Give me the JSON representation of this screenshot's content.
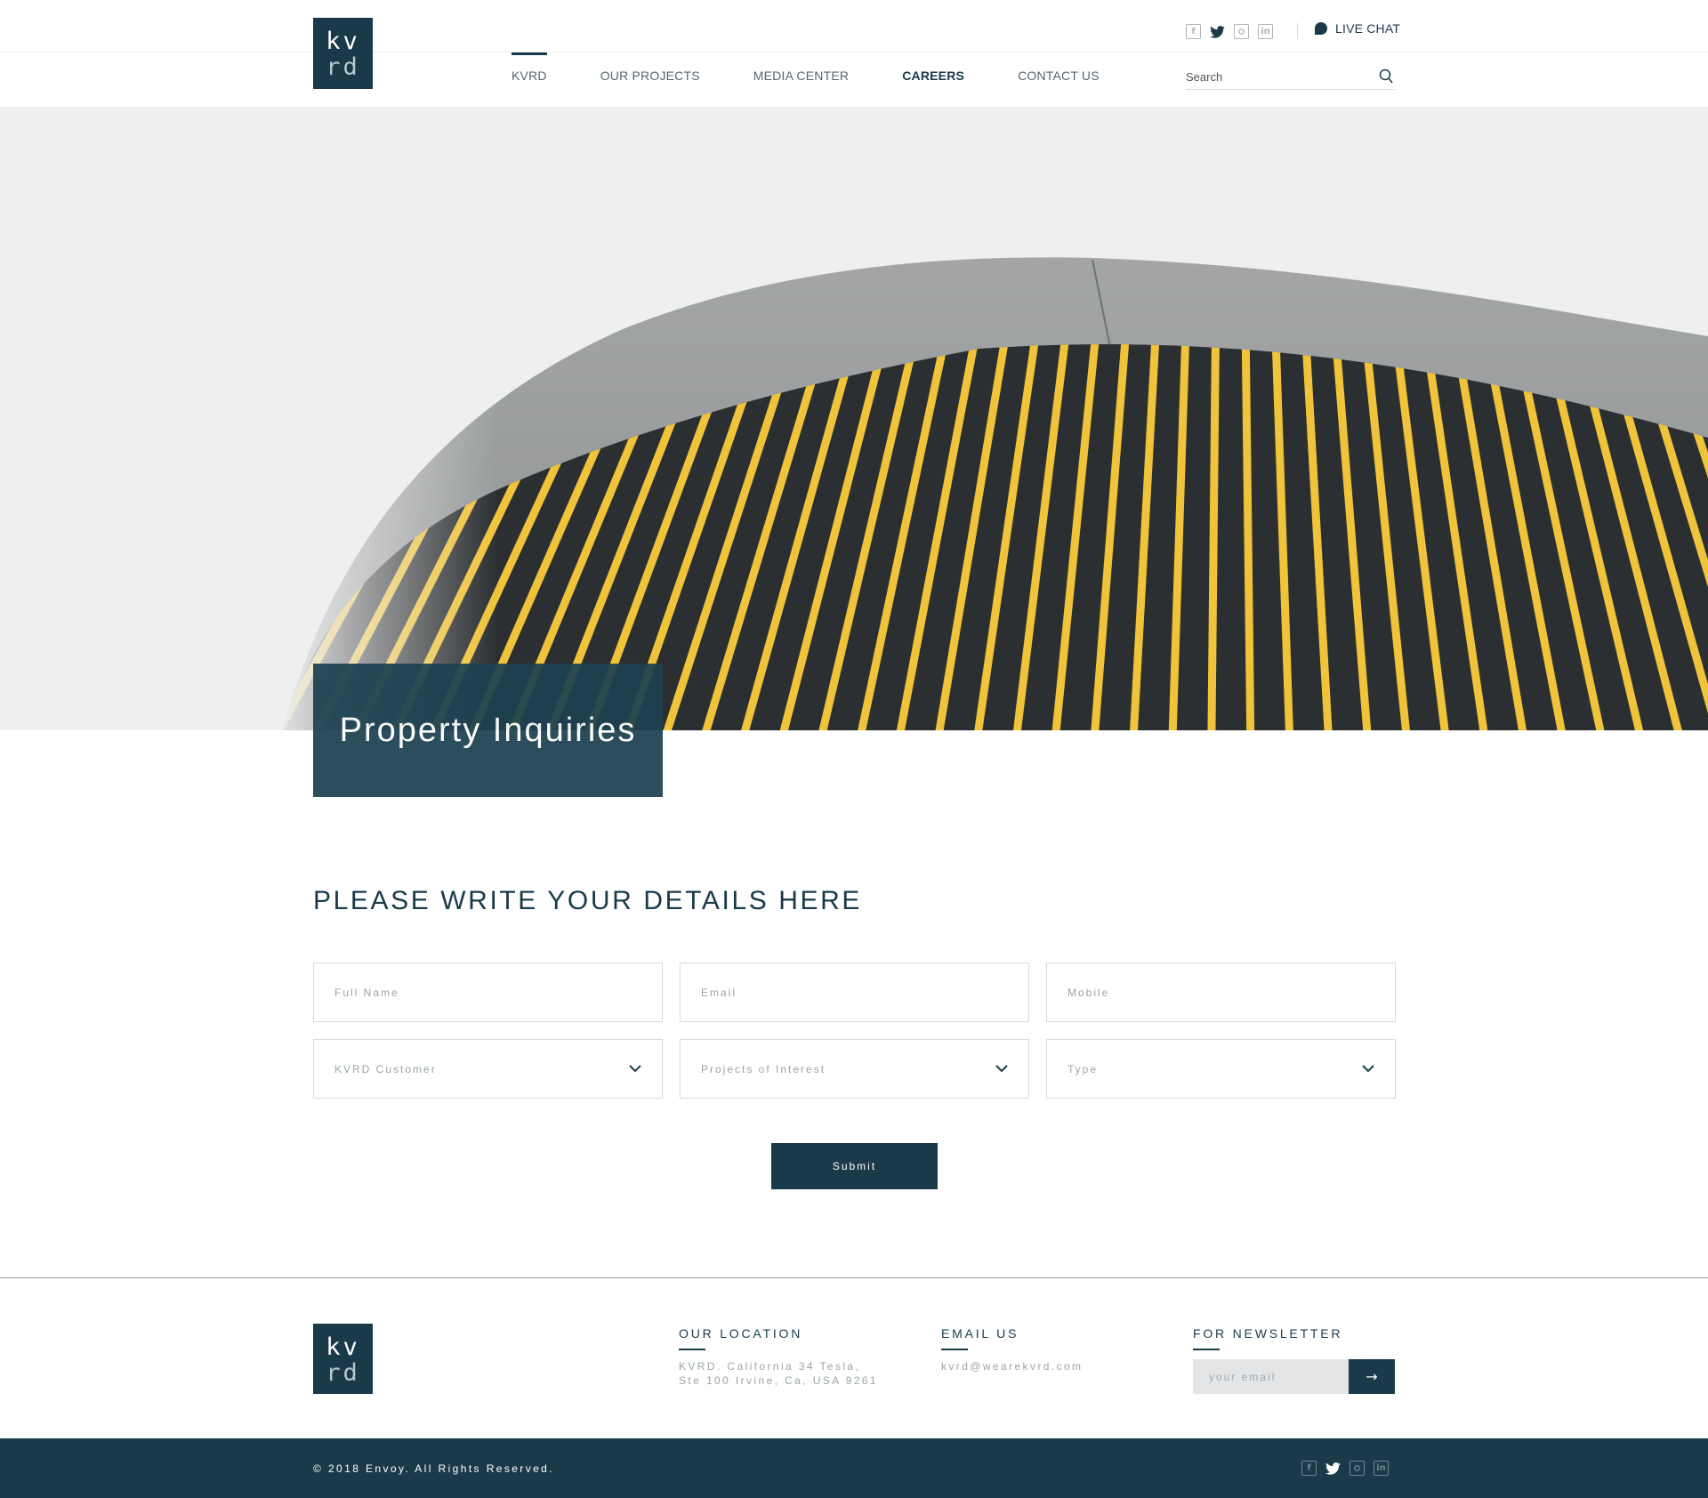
{
  "brand": {
    "logo_line1": "kv",
    "logo_line2": "rd"
  },
  "header": {
    "social": [
      {
        "name": "facebook",
        "glyph": "f"
      },
      {
        "name": "twitter",
        "glyph": "🐦"
      },
      {
        "name": "instagram",
        "glyph": "◎"
      },
      {
        "name": "linkedin",
        "glyph": "in"
      }
    ],
    "live_chat": "LIVE CHAT",
    "search_placeholder": "Search"
  },
  "nav": {
    "items": [
      {
        "label": "KVRD",
        "active": true
      },
      {
        "label": "OUR PROJECTS"
      },
      {
        "label": "MEDIA CENTER"
      },
      {
        "label": "CAREERS",
        "emphasis": true
      },
      {
        "label": "CONTACT US"
      }
    ]
  },
  "hero": {
    "title": "Property Inquiries"
  },
  "form": {
    "heading": "PLEASE WRITE YOUR DETAILS HERE",
    "full_name_placeholder": "Full Name",
    "email_placeholder": "Email",
    "mobile_placeholder": "Mobile",
    "customer_select": "KVRD Customer",
    "projects_select": "Projects of Interest",
    "type_select": "Type",
    "submit_label": "Submit"
  },
  "footer": {
    "location_title": "OUR LOCATION",
    "location_text": "KVRD. California 34 Tesla,\nSte 100 Irvine, Ca, USA 9261",
    "email_title": "EMAIL US",
    "email_text": "kvrd@wearekvrd.com",
    "newsletter_title": "FOR NEWSLETTER",
    "newsletter_placeholder": "your email",
    "newsletter_button": "→",
    "copyright": "© 2018 Envoy. All Rights Reserved."
  },
  "colors": {
    "primary": "#1a3a4a",
    "hero_box": "#1d4150",
    "accent_yellow": "#f0c43a"
  }
}
